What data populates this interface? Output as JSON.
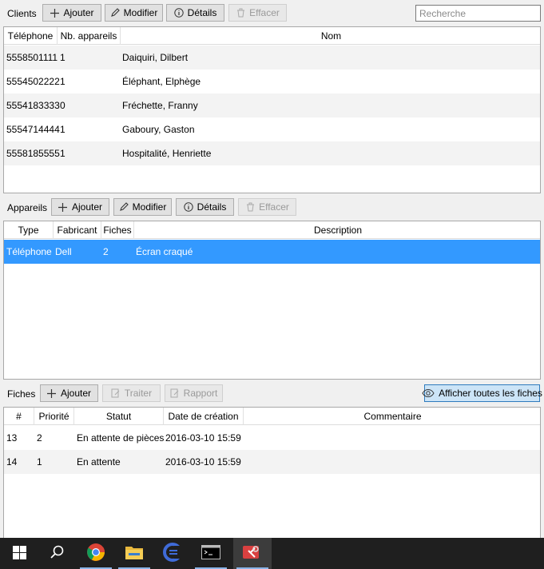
{
  "clients": {
    "label": "Clients",
    "buttons": {
      "add": "Ajouter",
      "edit": "Modifier",
      "details": "Détails",
      "delete": "Effacer"
    },
    "search_placeholder": "Recherche",
    "columns": [
      "Téléphone",
      "Nb. appareils",
      "Nom"
    ],
    "rows": [
      {
        "phone": "5558501111",
        "devices": "1",
        "name": "Daiquiri, Dilbert"
      },
      {
        "phone": "5554502222",
        "devices": "1",
        "name": "Éléphant, Elphège"
      },
      {
        "phone": "5554183333",
        "devices": "0",
        "name": "Fréchette, Franny"
      },
      {
        "phone": "5554714444",
        "devices": "1",
        "name": "Gaboury, Gaston"
      },
      {
        "phone": "5558185555",
        "devices": "1",
        "name": "Hospitalité, Henriette"
      }
    ]
  },
  "appareils": {
    "label": "Appareils",
    "buttons": {
      "add": "Ajouter",
      "edit": "Modifier",
      "details": "Détails",
      "delete": "Effacer"
    },
    "columns": [
      "Type",
      "Fabricant",
      "Fiches",
      "Description"
    ],
    "rows": [
      {
        "type": "Téléphone",
        "maker": "Dell",
        "tickets": "2",
        "description": "Écran craqué"
      }
    ]
  },
  "fiches": {
    "label": "Fiches",
    "buttons": {
      "add": "Ajouter",
      "process": "Traiter",
      "report": "Rapport",
      "show_all": "Afficher toutes les fiches"
    },
    "columns": [
      "#",
      "Priorité",
      "Statut",
      "Date de création",
      "Commentaire"
    ],
    "rows": [
      {
        "id": "13",
        "priority": "2",
        "status": "En attente de pièces",
        "created": "2016-03-10 15:59",
        "comment": ""
      },
      {
        "id": "14",
        "priority": "1",
        "status": "En attente",
        "created": "2016-03-10 15:59",
        "comment": ""
      }
    ]
  },
  "taskbar": {
    "items": [
      "start-icon",
      "search-icon",
      "chrome-icon",
      "file-explorer-icon",
      "eclipse-icon",
      "terminal-icon",
      "repair-app-icon"
    ]
  }
}
